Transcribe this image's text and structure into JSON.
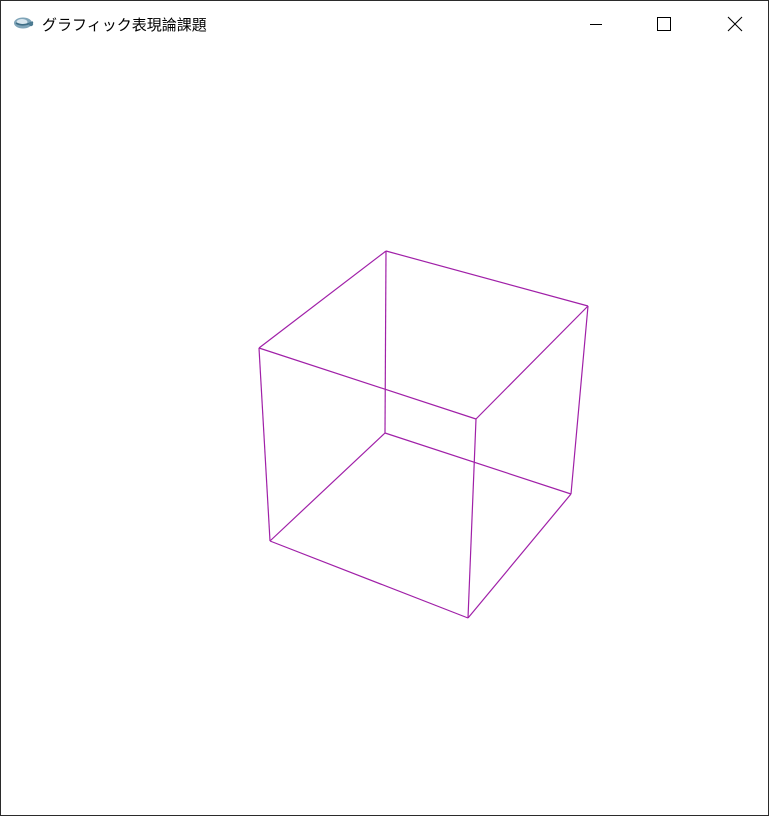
{
  "window": {
    "title": "グラフィック表現論課題",
    "app_icon": "app-icon",
    "controls": {
      "minimize": "minimize-icon",
      "maximize": "maximize-icon",
      "close": "close-icon"
    }
  },
  "canvas": {
    "background_color": "#ffffff",
    "wireframe_color": "#a020a8",
    "shape": "cube-wireframe"
  }
}
